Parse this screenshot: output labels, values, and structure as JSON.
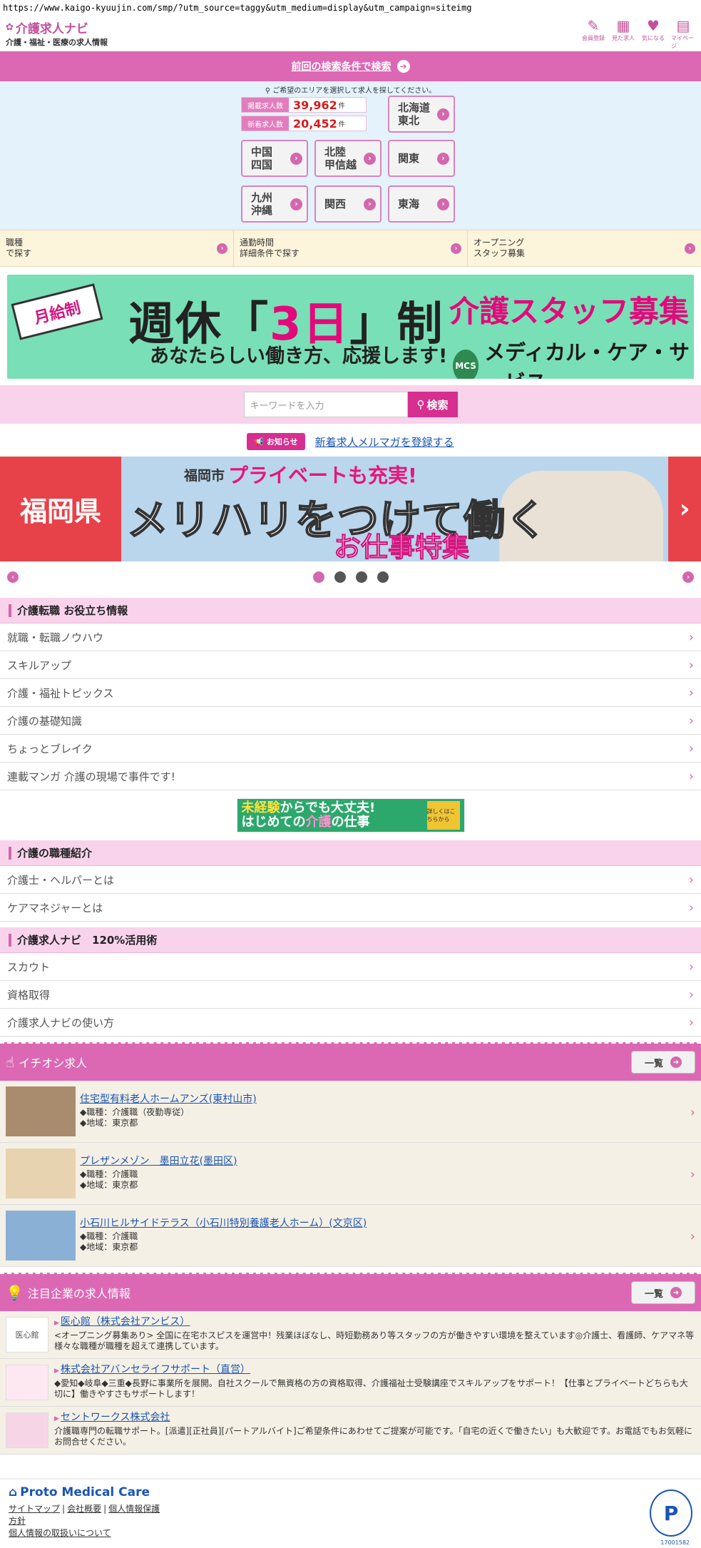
{
  "browser": {
    "url": "https://www.kaigo-kyuujin.com/smp/?utm_source=taggy&utm_medium=display&utm_campaign=siteimg"
  },
  "header": {
    "logo_title": "介護求人ナビ",
    "logo_sub": "介護・福祉・医療の求人情報",
    "icons": [
      {
        "label": "会員登録",
        "icon": "pencil-icon"
      },
      {
        "label": "見た求人",
        "icon": "calendar-icon"
      },
      {
        "label": "気になる",
        "icon": "heart-icon"
      },
      {
        "label": "マイページ",
        "icon": "mypage-icon"
      }
    ]
  },
  "prev_search": {
    "label": "前回の検索条件で検索"
  },
  "area": {
    "hint": "ご希望のエリアを選択して求人を探してください。",
    "counts": [
      {
        "label": "掲載求人数",
        "value": "39,962",
        "unit": "件"
      },
      {
        "label": "新着求人数",
        "value": "20,452",
        "unit": "件"
      }
    ],
    "regions": [
      "北海道\n東北",
      "中国\n四国",
      "北陸\n甲信越",
      "関東",
      "九州\n沖縄",
      "関西",
      "東海"
    ]
  },
  "categories": [
    "職種\nで探す",
    "通勤時間\n詳細条件で探す",
    "オープニング\nスタッフ募集"
  ],
  "banner1": {
    "ribbon": "月給制",
    "main_a": "週休「",
    "main_b": "3日",
    "main_c": "」制",
    "sub": "あなたらしい働き方、応援します!",
    "right": "介護スタッフ募集",
    "company": "メディカル・ケア・サービス",
    "logo": "MCS"
  },
  "search": {
    "placeholder": "キーワードを入力",
    "button": "検索"
  },
  "notice": {
    "tag": "お知らせ",
    "link": "新着求人メルマガを登録する"
  },
  "banner2": {
    "left": "福岡県",
    "city": "福岡市",
    "top": "プライベートも充実!",
    "main": "メリハリをつけて働く",
    "bottom": "お仕事特集"
  },
  "carousel": {
    "count": 4,
    "active": 0
  },
  "sections": [
    {
      "title": "介護転職 お役立ち情報",
      "items": [
        "就職・転職ノウハウ",
        "スキルアップ",
        "介護・福祉トピックス",
        "介護の基礎知識",
        "ちょっとブレイク",
        "連載マンガ 介護の現場で事件です!"
      ]
    },
    {
      "title": "介護の職種紹介",
      "items": [
        "介護士・ヘルパーとは",
        "ケアマネジャーとは"
      ]
    },
    {
      "title": "介護求人ナビ　120%活用術",
      "items": [
        "スカウト",
        "資格取得",
        "介護求人ナビの使い方"
      ]
    }
  ],
  "mini_banner": {
    "line1a": "未経験",
    "line1b": "からでも大丈夫!",
    "line2a": "はじめての",
    "line2b": "介護",
    "line2c": "の仕事",
    "badge": "詳しくはこちらから"
  },
  "pickup": {
    "title": "イチオシ求人",
    "list_label": "一覧",
    "jobs": [
      {
        "name": "住宅型有料老人ホームアンズ(東村山市)",
        "type": "◆職種：介護職（夜勤専従）",
        "area": "◆地域：東京都"
      },
      {
        "name": "プレザンメゾン　墨田立花(墨田区)",
        "type": "◆職種：介護職",
        "area": "◆地域：東京都"
      },
      {
        "name": "小石川ヒルサイドテラス（小石川特別養護老人ホーム）(文京区)",
        "type": "◆職種：介護職",
        "area": "◆地域：東京都"
      }
    ]
  },
  "featured": {
    "title": "注目企業の求人情報",
    "list_label": "一覧",
    "companies": [
      {
        "name": "医心館（株式会社アンビス）",
        "desc": "<オープニング募集あり> 全国に在宅ホスピスを運営中！残業ほぼなし、時短勤務あり等スタッフの方が働きやすい環境を整えています◎介護士、看護師、ケアマネ等様々な職種が職種を超えて連携しています。",
        "logo": "医心館"
      },
      {
        "name": "株式会社アバンセライフサポート（直営）",
        "desc": "◆愛知◆岐阜◆三重◆長野に事業所を展開。自社スクールで無資格の方の資格取得、介護福祉士受験講座でスキルアップをサポート！【仕事とプライベートどちらも大切に】働きやすさもサポートします！",
        "logo": ""
      },
      {
        "name": "セントワークス株式会社",
        "desc": "介護職専門の転職サポート。[派遣][正社員][パートアルバイト]ご希望条件にあわせてご提案が可能です。「自宅の近くで働きたい」も大歓迎です。お電話でもお気軽にお問合せください。",
        "logo": ""
      }
    ]
  },
  "footer": {
    "logo": "Proto Medical Care",
    "links_row1": [
      "サイトマップ",
      "会社概要",
      "個人情報保護"
    ],
    "links_row1b": "方針",
    "links_row2": "個人情報の取扱いについて",
    "pmark_num": "17001582"
  }
}
